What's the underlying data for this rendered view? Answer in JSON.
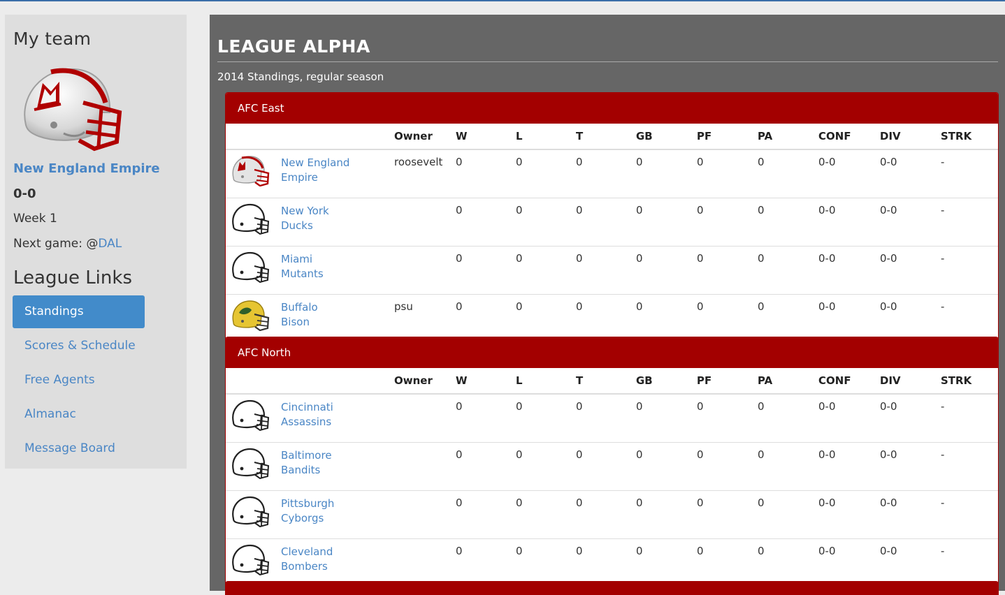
{
  "sidebar": {
    "my_team_heading": "My team",
    "team_name": "New England Empire",
    "record": "0-0",
    "week": "Week 1",
    "next_game_label": "Next game: @",
    "next_game_opponent": "DAL",
    "links_heading": "League Links",
    "nav": [
      {
        "label": "Standings",
        "active": true
      },
      {
        "label": "Scores & Schedule",
        "active": false
      },
      {
        "label": "Free Agents",
        "active": false
      },
      {
        "label": "Almanac",
        "active": false
      },
      {
        "label": "Message Board",
        "active": false
      }
    ]
  },
  "main": {
    "league_title": "LEAGUE ALPHA",
    "subtitle": "2014 Standings, regular season",
    "columns": [
      "",
      "",
      "Owner",
      "W",
      "L",
      "T",
      "GB",
      "PF",
      "PA",
      "CONF",
      "DIV",
      "STRK"
    ],
    "divisions": [
      {
        "name": "AFC East",
        "teams": [
          {
            "line1": "New England",
            "line2": "Empire",
            "owner": "roosevelt",
            "logo": "red-white-helmet-icon",
            "w": "0",
            "l": "0",
            "t": "0",
            "gb": "0",
            "pf": "0",
            "pa": "0",
            "conf": "0-0",
            "div": "0-0",
            "strk": "-"
          },
          {
            "line1": "New York",
            "line2": "Ducks",
            "owner": "",
            "logo": "outline-helmet-icon",
            "w": "0",
            "l": "0",
            "t": "0",
            "gb": "0",
            "pf": "0",
            "pa": "0",
            "conf": "0-0",
            "div": "0-0",
            "strk": "-"
          },
          {
            "line1": "Miami",
            "line2": "Mutants",
            "owner": "",
            "logo": "outline-helmet-icon",
            "w": "0",
            "l": "0",
            "t": "0",
            "gb": "0",
            "pf": "0",
            "pa": "0",
            "conf": "0-0",
            "div": "0-0",
            "strk": "-"
          },
          {
            "line1": "Buffalo",
            "line2": "Bison",
            "owner": "psu",
            "logo": "yellow-helmet-icon",
            "w": "0",
            "l": "0",
            "t": "0",
            "gb": "0",
            "pf": "0",
            "pa": "0",
            "conf": "0-0",
            "div": "0-0",
            "strk": "-"
          }
        ]
      },
      {
        "name": "AFC North",
        "teams": [
          {
            "line1": "Cincinnati",
            "line2": "Assassins",
            "owner": "",
            "logo": "outline-helmet-icon",
            "w": "0",
            "l": "0",
            "t": "0",
            "gb": "0",
            "pf": "0",
            "pa": "0",
            "conf": "0-0",
            "div": "0-0",
            "strk": "-"
          },
          {
            "line1": "Baltimore",
            "line2": "Bandits",
            "owner": "",
            "logo": "outline-helmet-icon",
            "w": "0",
            "l": "0",
            "t": "0",
            "gb": "0",
            "pf": "0",
            "pa": "0",
            "conf": "0-0",
            "div": "0-0",
            "strk": "-"
          },
          {
            "line1": "Pittsburgh",
            "line2": "Cyborgs",
            "owner": "",
            "logo": "outline-helmet-icon",
            "w": "0",
            "l": "0",
            "t": "0",
            "gb": "0",
            "pf": "0",
            "pa": "0",
            "conf": "0-0",
            "div": "0-0",
            "strk": "-"
          },
          {
            "line1": "Cleveland",
            "line2": "Bombers",
            "owner": "",
            "logo": "outline-helmet-icon",
            "w": "0",
            "l": "0",
            "t": "0",
            "gb": "0",
            "pf": "0",
            "pa": "0",
            "conf": "0-0",
            "div": "0-0",
            "strk": "-"
          }
        ]
      }
    ]
  },
  "colors": {
    "division_header": "#a30000",
    "link": "#4a86c5",
    "active_nav": "#428bca",
    "main_bg": "#666666",
    "sidebar_bg": "#dedede"
  }
}
